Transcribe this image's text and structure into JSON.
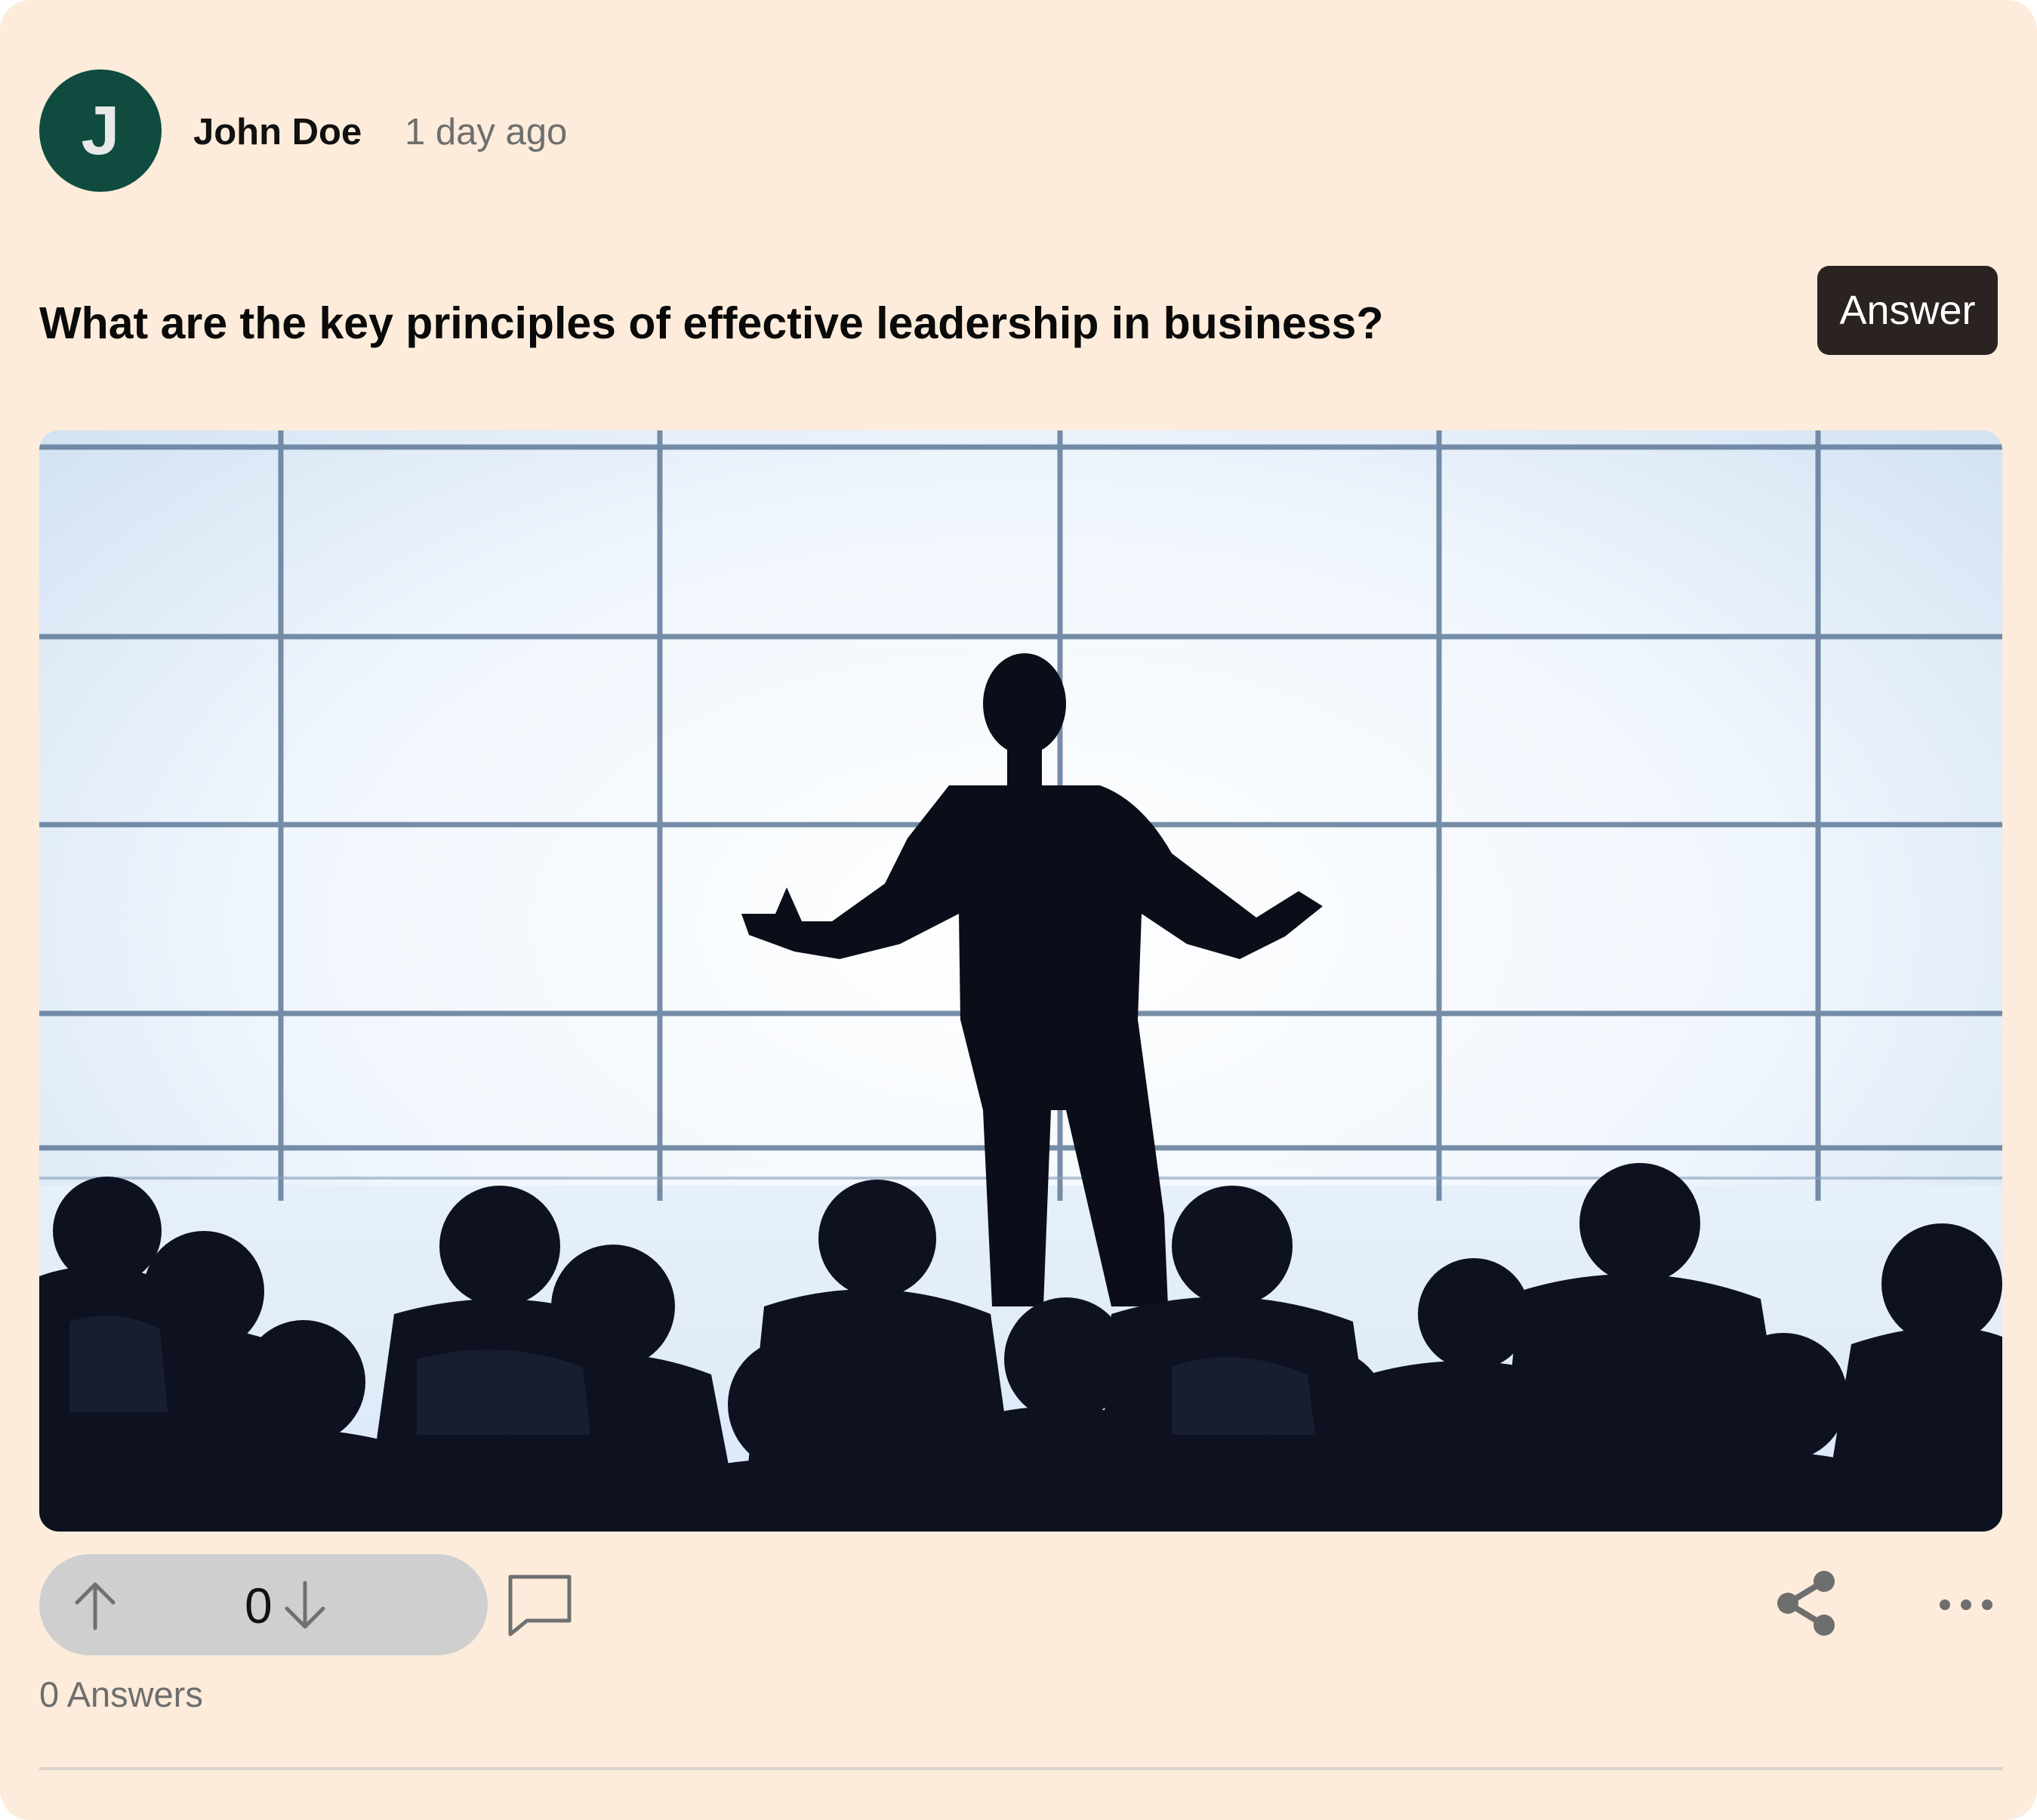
{
  "post": {
    "author": {
      "initial": "J",
      "name": "John Doe",
      "avatar_color": "#0f4c3f"
    },
    "timestamp": "1 day ago",
    "question": "What are the key principles of effective leadership in business?",
    "answer_button_label": "Answer",
    "image_alt": "Silhouette of a speaker presenting to an audience in front of a bright window grid"
  },
  "actions": {
    "upvote_icon": "arrow-up-icon",
    "vote_count": "0",
    "downvote_icon": "arrow-down-icon",
    "comment_icon": "comment-icon",
    "share_icon": "share-icon",
    "more_icon": "more-icon"
  },
  "footer": {
    "answers_count_label": "0 Answers"
  },
  "colors": {
    "card_background": "#fdecdb",
    "answer_button": "#2b2321",
    "vote_pill": "#cfcfcf",
    "muted_text": "#6e6e6e"
  }
}
